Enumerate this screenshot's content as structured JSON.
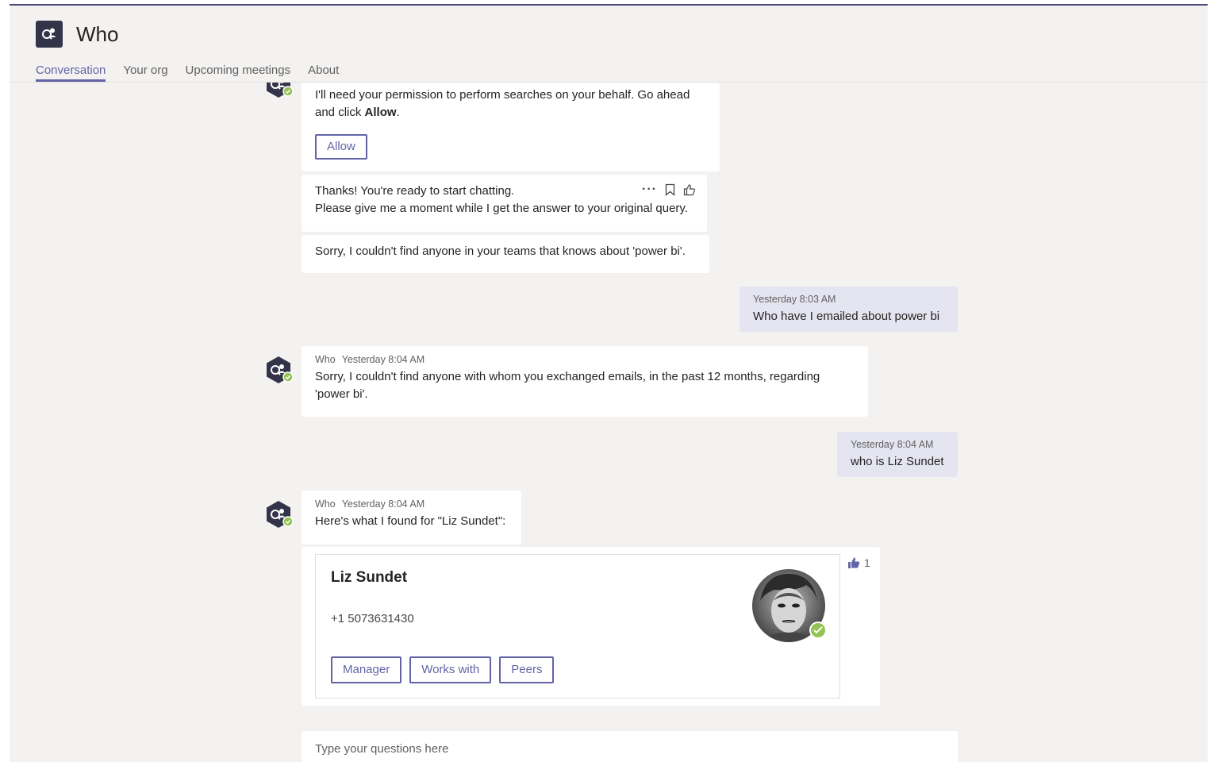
{
  "app": {
    "title": "Who"
  },
  "tabs": [
    {
      "label": "Conversation",
      "active": true
    },
    {
      "label": "Your org",
      "active": false
    },
    {
      "label": "Upcoming meetings",
      "active": false
    },
    {
      "label": "About",
      "active": false
    }
  ],
  "messages": {
    "permission": {
      "text_before": "I'll need your permission to perform searches on your behalf. Go ahead and click ",
      "text_bold": "Allow",
      "text_after": ".",
      "button": "Allow"
    },
    "ready": {
      "line1": "Thanks! You're ready to start chatting.",
      "line2": "Please give me a moment while I get the answer to your original query."
    },
    "sorry_teams": "Sorry, I couldn't find anyone in your teams that knows about 'power bi'.",
    "user1": {
      "time": "Yesterday 8:03 AM",
      "text": "Who have I emailed about power bi"
    },
    "bot1": {
      "sender": "Who",
      "time": "Yesterday 8:04 AM",
      "text": "Sorry, I couldn't find anyone with whom you exchanged emails, in the past 12 months, regarding 'power bi'."
    },
    "user2": {
      "time": "Yesterday 8:04 AM",
      "text": "who is Liz Sundet"
    },
    "bot2": {
      "sender": "Who",
      "time": "Yesterday 8:04 AM",
      "text": "Here's what I found for \"Liz Sundet\":"
    }
  },
  "person_card": {
    "name": "Liz Sundet",
    "phone": "+1 5073631430",
    "buttons": [
      "Manager",
      "Works with",
      "Peers"
    ],
    "reaction_count": "1"
  },
  "composer": {
    "placeholder": "Type your questions here"
  },
  "colors": {
    "accent": "#6264a7",
    "header_bar": "#464775",
    "bot_avatar": "#33344a",
    "presence": "#92c353",
    "my_bubble": "#e5e5f1"
  }
}
